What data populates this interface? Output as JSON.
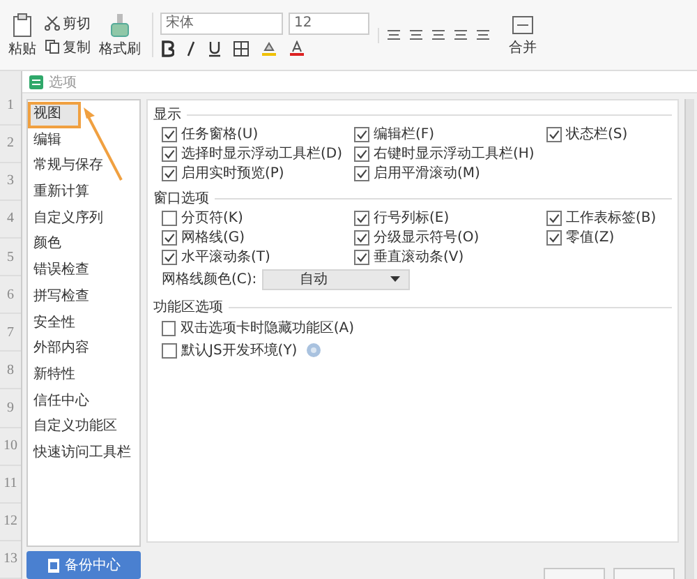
{
  "toolbar": {
    "paste": "粘贴",
    "cut": "剪切",
    "copy": "复制",
    "format_painter": "格式刷",
    "font": "宋体",
    "font_size": "12",
    "merge": "合并"
  },
  "dialog": {
    "title": "选项"
  },
  "row_numbers": [
    "1",
    "2",
    "3",
    "4",
    "5",
    "6",
    "7",
    "8",
    "9",
    "10",
    "11",
    "12",
    "13"
  ],
  "sidebar": {
    "items": [
      {
        "label": "视图",
        "selected": true
      },
      {
        "label": "编辑",
        "selected": false
      },
      {
        "label": "常规与保存",
        "selected": false
      },
      {
        "label": "重新计算",
        "selected": false
      },
      {
        "label": "自定义序列",
        "selected": false
      },
      {
        "label": "颜色",
        "selected": false
      },
      {
        "label": "错误检查",
        "selected": false
      },
      {
        "label": "拼写检查",
        "selected": false
      },
      {
        "label": "安全性",
        "selected": false
      },
      {
        "label": "外部内容",
        "selected": false
      },
      {
        "label": "新特性",
        "selected": false
      },
      {
        "label": "信任中心",
        "selected": false
      },
      {
        "label": "自定义功能区",
        "selected": false
      },
      {
        "label": "快速访问工具栏",
        "selected": false
      }
    ],
    "backup_button": "备份中心"
  },
  "sections": [
    {
      "title": "显示",
      "options": [
        {
          "label": "任务窗格(U)",
          "checked": true
        },
        {
          "label": "编辑栏(F)",
          "checked": true
        },
        {
          "label": "状态栏(S)",
          "checked": true
        },
        {
          "label": "选择时显示浮动工具栏(D)",
          "checked": true
        },
        {
          "label": "右键时显示浮动工具栏(H)",
          "checked": true
        },
        {
          "label": "启用实时预览(P)",
          "checked": true
        },
        {
          "label": "启用平滑滚动(M)",
          "checked": true
        }
      ]
    },
    {
      "title": "窗口选项",
      "options": [
        {
          "label": "分页符(K)",
          "checked": false
        },
        {
          "label": "行号列标(E)",
          "checked": true
        },
        {
          "label": "工作表标签(B)",
          "checked": true
        },
        {
          "label": "网格线(G)",
          "checked": true
        },
        {
          "label": "分级显示符号(O)",
          "checked": true
        },
        {
          "label": "零值(Z)",
          "checked": true
        },
        {
          "label": "水平滚动条(T)",
          "checked": true
        },
        {
          "label": "垂直滚动条(V)",
          "checked": true
        }
      ],
      "grid_color": {
        "label": "网格线颜色(C):",
        "value": "自动"
      }
    },
    {
      "title": "功能区选项",
      "options": [
        {
          "label": "双击选项卡时隐藏功能区(A)",
          "checked": false
        },
        {
          "label": "默认JS开发环境(Y)",
          "checked": false,
          "help": true
        }
      ]
    }
  ]
}
